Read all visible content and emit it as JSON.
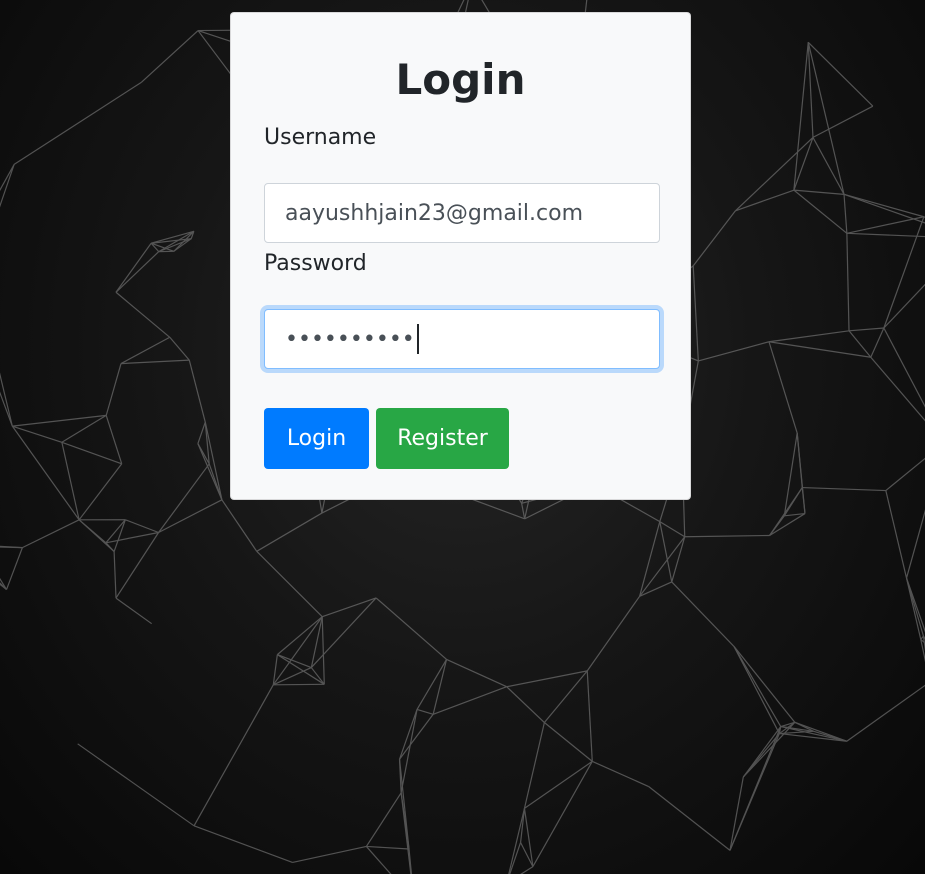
{
  "login_card": {
    "title": "Login",
    "username_label": "Username",
    "username_value": "aayushhjain23@gmail.com",
    "password_label": "Password",
    "password_masked": "••••••••••",
    "login_button": "Login",
    "register_button": "Register"
  },
  "colors": {
    "login_button": "#007bff",
    "register_button": "#28a745",
    "card_background": "#f8f9fa",
    "focus_ring": "#80bdff"
  }
}
